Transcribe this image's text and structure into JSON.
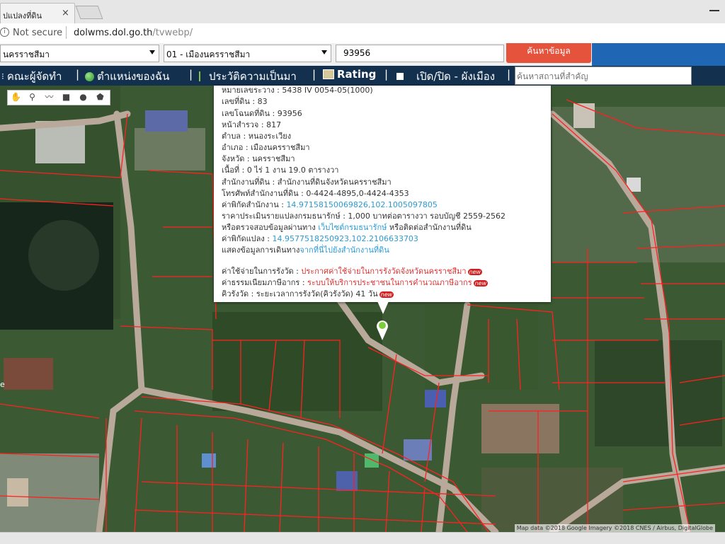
{
  "browser": {
    "tab_title": "ปแปลงที่ดิน",
    "tab_close": "×",
    "security_label": "Not secure",
    "url_host": "dolwms.dol.go.th",
    "url_path": "/tvwebp/"
  },
  "form": {
    "province_value": "นครราชสีมา",
    "district_value": "01 - เมืองนครราชสีมา",
    "deed_number": "93956",
    "search_button": "ค้นหาข้อมูล"
  },
  "nav": {
    "items": [
      {
        "label": "คณะผู้จัดทำ",
        "icon": "info-icon"
      },
      {
        "label": "ตำแหน่งของฉัน",
        "icon": "globe-icon"
      },
      {
        "label": "ประวัติความเป็นมา",
        "icon": "sprout-icon"
      },
      {
        "label": "Rating",
        "icon": "chart-icon"
      },
      {
        "label": "เปิด/ปิด - ผังเมือง",
        "icon": "checkbox-icon"
      }
    ],
    "separator": "|",
    "search_placeholder": "ค้นหาสถานที่สำคัญ"
  },
  "popup": {
    "lines": [
      {
        "label": "หมายเลขระวาง",
        "value": "5438 IV 0054-05(1000)"
      },
      {
        "label": "เลขที่ดิน",
        "value": "83"
      },
      {
        "label": "เลขโฉนดที่ดิน",
        "value": "93956"
      },
      {
        "label": "หน้าสำรวจ",
        "value": "817"
      },
      {
        "label": "ตำบล",
        "value": "หนองระเวียง"
      },
      {
        "label": "อำเภอ",
        "value": "เมืองนครราชสีมา"
      },
      {
        "label": "จังหวัด",
        "value": "นครราชสีมา"
      },
      {
        "label": "เนื้อที่",
        "value": "0 ไร่ 1 งาน 19.0 ตารางวา"
      },
      {
        "label": "สำนักงานที่ดิน",
        "value": "สำนักงานที่ดินจังหวัดนครราชสีมา"
      },
      {
        "label": "โทรศัพท์สำนักงานที่ดิน",
        "value": "0-4424-4895,0-4424-4353"
      }
    ],
    "office_coord_label": "ค่าพิกัดสำนักงาน",
    "office_coord_value": "14.97158150069826,102.1005097805",
    "appraisal_text": "ราคาประเมินรายแปลงกรมธนารักษ์ : 1,000 บาทต่อตารางวา รอบบัญชี 2559-2562",
    "check_prefix": "หรือตรวจสอบข้อมูลผ่านทาง",
    "check_link": "เว็บไซต์กรมธนารักษ์",
    "check_suffix": "หรือติดต่อสำนักงานที่ดิน",
    "parcel_coord_label": "ค่าพิกัดแปลง",
    "parcel_coord_value": "14.9577518250923,102.2106633703",
    "route_label": "แสดงข้อมูลการเดินทาง",
    "route_link": "จากที่นี่ไปยังสำนักงานที่ดิน",
    "fee_label": "ค่าใช้จ่ายในการรังวัด",
    "fee_link": "ประกาศค่าใช้จ่ายในการรังวัดจังหวัดนครราชสีมา",
    "tax_label": "ค่าธรรมเนียมภาษีอากร",
    "tax_link": "ระบบให้บริการประชาชนในการคำนวณภาษีอากร",
    "queue_label": "คิวรังวัด",
    "queue_value": "ระยะเวลาการรังวัด(คิวรังวัด) 41 วัน",
    "new_badge": "new"
  },
  "map": {
    "attribution": "Map data ©2018 Google Imagery ©2018 CNES / Airbus, DigitalGlobe",
    "side_text": "e",
    "tools": [
      "pan-icon",
      "marker-icon",
      "polyline-icon",
      "rectangle-icon",
      "circle-icon",
      "polygon-icon"
    ]
  },
  "colors": {
    "nav_bg": "#14304f",
    "search_btn": "#e5533d",
    "parcel_lines": "#ff2020",
    "link": "#2a9ad6"
  }
}
